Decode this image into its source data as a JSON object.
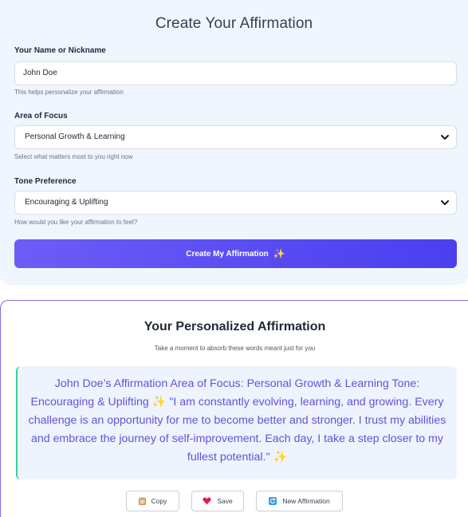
{
  "form": {
    "title": "Create Your Affirmation",
    "name_label": "Your Name or Nickname",
    "name_value": "John Doe",
    "name_help": "This helps personalize your affirmation",
    "focus_label": "Area of Focus",
    "focus_value": "Personal Growth & Learning",
    "focus_help": "Select what matters most to you right now",
    "tone_label": "Tone Preference",
    "tone_value": "Encouraging & Uplifting",
    "tone_help": "How would you like your affirmation to feel?",
    "submit_label": "Create My Affirmation",
    "submit_icon": "✨"
  },
  "result": {
    "title": "Your Personalized Affirmation",
    "subtitle": "Take a moment to absorb these words meant just for you",
    "affirmation": "John Doe’s Affirmation Area of Focus: Personal Growth & Learning Tone: Encouraging & Uplifting ✨ \"I am constantly evolving, learning, and growing. Every challenge is an opportunity for me to become better and stronger. I trust my abilities and embrace the journey of self-improvement. Each day, I take a step closer to my fullest potential.\" ✨",
    "actions": {
      "copy_label": "Copy",
      "save_label": "Save",
      "new_label": "New Affirmation"
    }
  },
  "colors": {
    "accent": "#5b4cf3",
    "quote_text": "#6352d9",
    "quote_border": "#34d399",
    "panel_bg": "#f0f6fe"
  },
  "icons": {
    "copy": "clipboard-icon",
    "save": "heart-icon",
    "new": "refresh-icon",
    "select": "chevron-down-icon",
    "sparkle": "sparkle-icon"
  }
}
